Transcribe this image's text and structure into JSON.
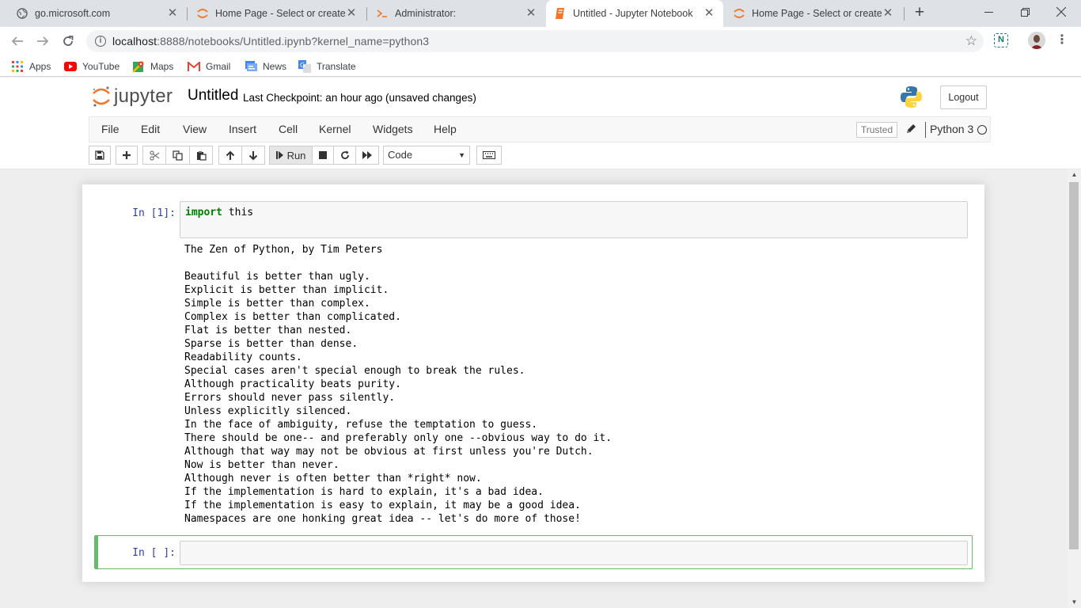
{
  "browser": {
    "tabs": [
      {
        "title": "go.microsoft.com",
        "icon": "globe-icon"
      },
      {
        "title": "Home Page - Select or create a",
        "icon": "jupyter-tab-icon"
      },
      {
        "title": "Administrator:",
        "icon": "powershell-icon"
      },
      {
        "title": "Untitled - Jupyter Notebook",
        "icon": "notebook-icon",
        "active": true
      },
      {
        "title": "Home Page - Select or create a",
        "icon": "jupyter-tab-icon"
      }
    ],
    "new_tab_label": "+",
    "url": {
      "host": "localhost",
      "rest": ":8888/notebooks/Untitled.ipynb?kernel_name=python3"
    },
    "bookmarks": [
      {
        "label": "Apps",
        "icon": "apps-grid-icon"
      },
      {
        "label": "YouTube",
        "icon": "youtube-icon"
      },
      {
        "label": "Maps",
        "icon": "maps-icon"
      },
      {
        "label": "Gmail",
        "icon": "gmail-icon"
      },
      {
        "label": "News",
        "icon": "news-icon"
      },
      {
        "label": "Translate",
        "icon": "translate-icon"
      }
    ]
  },
  "jupyter": {
    "logo_text": "jupyter",
    "notebook_name": "Untitled",
    "checkpoint": "Last Checkpoint: an hour ago",
    "autosave": "(unsaved changes)",
    "logout_label": "Logout",
    "menu": [
      "File",
      "Edit",
      "View",
      "Insert",
      "Cell",
      "Kernel",
      "Widgets",
      "Help"
    ],
    "trusted_label": "Trusted",
    "kernel_name": "Python 3",
    "run_label": "Run",
    "cell_type": "Code",
    "colors": {
      "accent_orange": "#f37726",
      "prompt_blue": "#303f9f",
      "selected_green": "#66bb6a",
      "keyword_green": "#008000"
    }
  },
  "cells": [
    {
      "prompt": "In [1]:",
      "code_keyword": "import",
      "code_rest": " this",
      "output": "The Zen of Python, by Tim Peters\n\nBeautiful is better than ugly.\nExplicit is better than implicit.\nSimple is better than complex.\nComplex is better than complicated.\nFlat is better than nested.\nSparse is better than dense.\nReadability counts.\nSpecial cases aren't special enough to break the rules.\nAlthough practicality beats purity.\nErrors should never pass silently.\nUnless explicitly silenced.\nIn the face of ambiguity, refuse the temptation to guess.\nThere should be one-- and preferably only one --obvious way to do it.\nAlthough that way may not be obvious at first unless you're Dutch.\nNow is better than never.\nAlthough never is often better than *right* now.\nIf the implementation is hard to explain, it's a bad idea.\nIf the implementation is easy to explain, it may be a good idea.\nNamespaces are one honking great idea -- let's do more of those!"
    },
    {
      "prompt": "In [ ]:"
    }
  ]
}
